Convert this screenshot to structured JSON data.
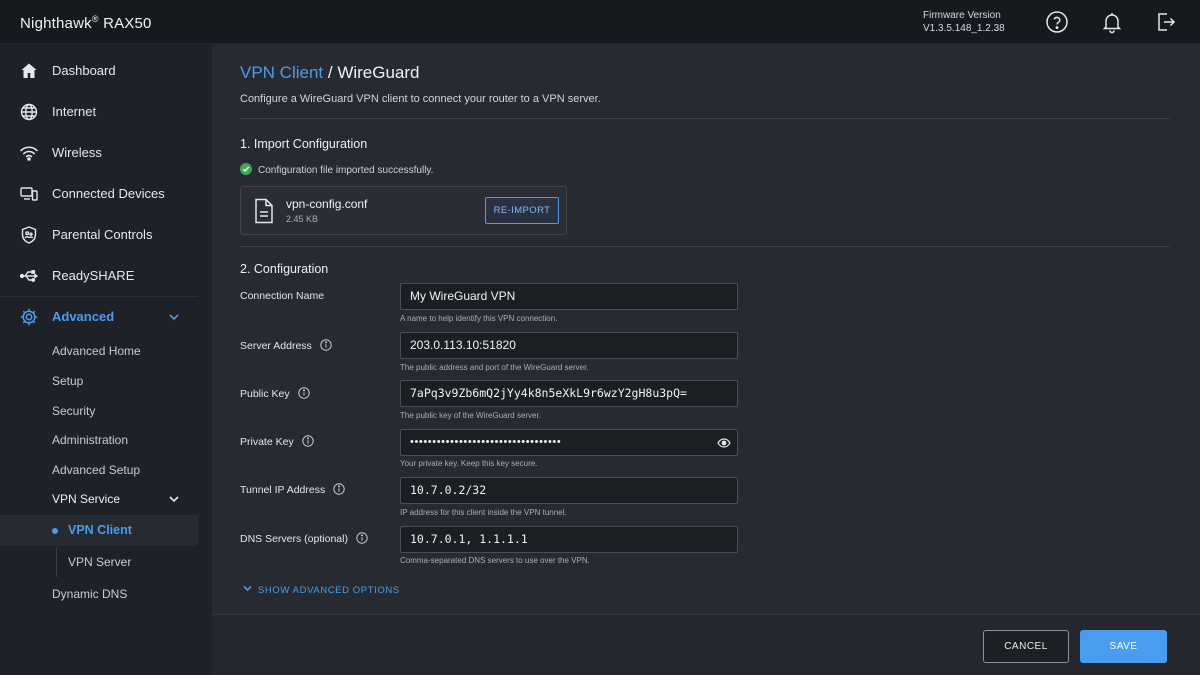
{
  "header": {
    "brand": "Nighthawk",
    "brand_mark": "®",
    "model": "RAX50",
    "firmware_label": "Firmware Version",
    "firmware_version": "V1.3.5.148_1.2.38",
    "icons": [
      "help-icon",
      "bell-icon",
      "logout-icon"
    ]
  },
  "sidebar": {
    "items": [
      {
        "label": "Dashboard",
        "icon": "home-icon"
      },
      {
        "label": "Internet",
        "icon": "globe-icon"
      },
      {
        "label": "Wireless",
        "icon": "wifi-icon"
      },
      {
        "label": "Connected Devices",
        "icon": "devices-icon"
      },
      {
        "label": "Parental Controls",
        "icon": "parental-icon"
      },
      {
        "label": "ReadySHARE",
        "icon": "usb-icon"
      }
    ],
    "advanced": {
      "label": "Advanced",
      "icon": "gear-icon"
    },
    "sub_items": [
      "Advanced Home",
      "Setup",
      "Security",
      "Administration",
      "Advanced Setup"
    ],
    "vpn_service": "VPN Service",
    "vpn_client": "VPN Client",
    "vpn_server": "VPN Server",
    "dynamic_dns": "Dynamic DNS"
  },
  "main": {
    "breadcrumb_link": "VPN Client",
    "breadcrumb_sep": " / ",
    "breadcrumb_current": "WireGuard",
    "description": "Configure a WireGuard VPN client to connect your router to a VPN server.",
    "section1_title": "1. Import Configuration",
    "success_message": "Configuration file imported successfully.",
    "file_name": "vpn-config.conf",
    "file_size": "2.45 KB",
    "reimport_label": "RE-IMPORT",
    "section2_title": "2. Configuration",
    "fields": [
      {
        "label": "Connection Name",
        "value": "My WireGuard VPN",
        "help": "A name to help identify this VPN connection."
      },
      {
        "label": "Server Address",
        "value": "203.0.113.10:51820",
        "help": "The public address and port of the WireGuard server."
      },
      {
        "label": "Public Key",
        "value": "7aPq3v9Zb6mQ2jYy4k8n5eXkL9r6wzY2gH8u3pQ=",
        "help": "The public key of the WireGuard server."
      },
      {
        "label": "Private Key",
        "value": "••••••••••••••••••••••••••••••••••",
        "help": "Your private key. Keep this key secure."
      },
      {
        "label": "Tunnel IP Address",
        "value": "10.7.0.2/32",
        "help": "IP address for this client inside the VPN tunnel."
      },
      {
        "label": "DNS Servers (optional)",
        "value": "10.7.0.1, 1.1.1.1",
        "help": "Comma-separated DNS servers to use over the VPN."
      }
    ],
    "advanced_toggle": "SHOW ADVANCED OPTIONS"
  },
  "footer": {
    "cancel_label": "CANCEL",
    "save_label": "SAVE"
  },
  "colors": {
    "accent": "#4a9cf0",
    "success": "#3ea55b",
    "background": "#272a30",
    "sidebar": "#1e2127"
  }
}
